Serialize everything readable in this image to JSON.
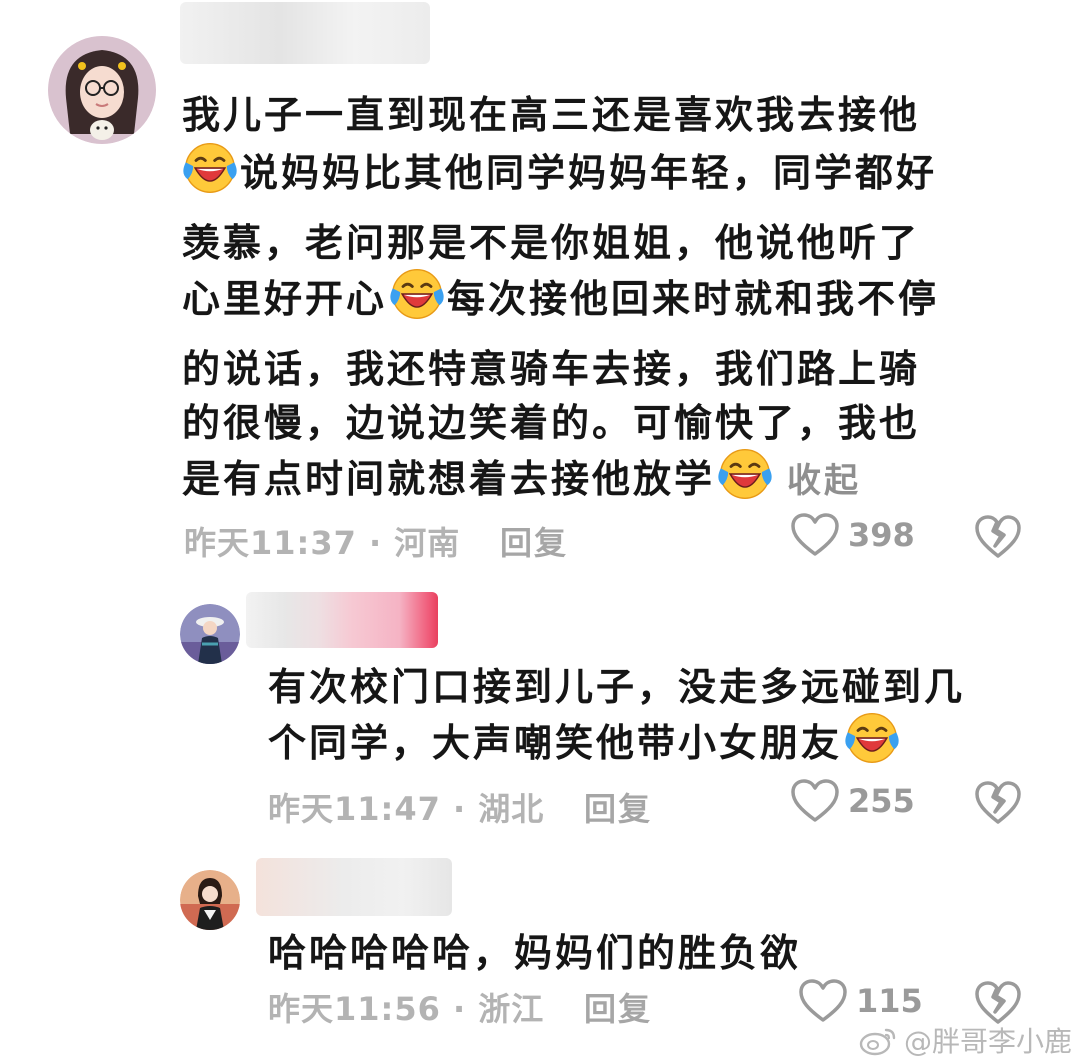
{
  "comments": [
    {
      "lines": [
        "我儿子一直到现在高三还是喜欢我去接他",
        "说妈妈比其他同学妈妈年轻，同学都好",
        "羡慕，老问那是不是你姐姐，他说他听了",
        "心里好开心",
        "每次接他回来时就和我不停",
        "的说话，我还特意骑车去接，我们路上骑",
        "的很慢，边说边笑着的。可愉快了，我也",
        "是有点时间就想着去接他放学"
      ],
      "collapse_label": "收起",
      "meta": "昨天11:37 · 河南",
      "reply_label": "回复",
      "likes": "398"
    },
    {
      "lines": [
        "有次校门口接到儿子，没走多远碰到几",
        "个同学，大声嘲笑他带小女朋友"
      ],
      "meta": "昨天11:47 · 湖北",
      "reply_label": "回复",
      "likes": "255"
    },
    {
      "lines": [
        "哈哈哈哈哈，妈妈们的胜负欲"
      ],
      "meta": "昨天11:56 · 浙江",
      "reply_label": "回复",
      "likes": "115"
    }
  ],
  "watermark": "@胖哥李小鹿",
  "icons": {
    "emoji": "laughing-crying-emoji",
    "like": "heart-outline-icon",
    "dislike": "broken-heart-icon",
    "watermark": "weibo-logo-icon"
  },
  "colors": {
    "meta_text": "#b3b3b3",
    "emoji_face": "#ffc93a",
    "emoji_tears": "#3aa0f0",
    "emoji_mouth": "#e0393b"
  }
}
